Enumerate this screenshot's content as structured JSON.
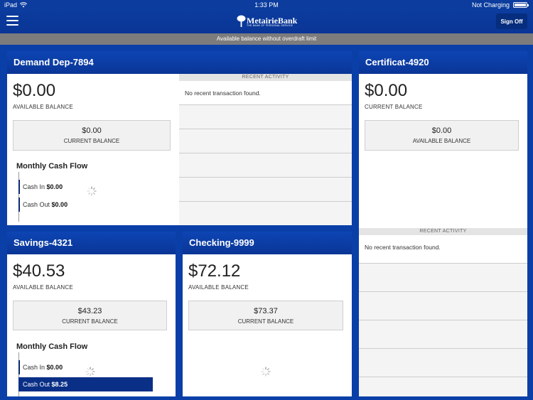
{
  "status_bar": {
    "device": "iPad",
    "time": "1:33 PM",
    "charging": "Not Charging"
  },
  "header": {
    "logo_name": "MetairieBank",
    "logo_tagline": "THE BANK OF PERSONAL SERVICE",
    "sign_off_label": "Sign Off"
  },
  "notice": "Available balance without overdraft limit",
  "accounts": {
    "demand": {
      "title": "Demand Dep-7894",
      "balance": "$0.00",
      "balance_label": "AVAILABLE BALANCE",
      "sub_value": "$0.00",
      "sub_label": "CURRENT BALANCE",
      "cash_flow_title": "Monthly Cash Flow",
      "cash_in_label": "Cash In",
      "cash_in_value": "$0.00",
      "cash_out_label": "Cash Out",
      "cash_out_value": "$0.00",
      "activity_header": "RECENT ACTIVITY",
      "activity_empty": "No recent transaction found."
    },
    "certificate": {
      "title": "Certificat-4920",
      "balance": "$0.00",
      "balance_label": "CURRENT BALANCE",
      "sub_value": "$0.00",
      "sub_label": "AVAILABLE BALANCE",
      "activity_header": "RECENT ACTIVITY",
      "activity_empty": "No recent transaction found."
    },
    "savings": {
      "title": "Savings-4321",
      "balance": "$40.53",
      "balance_label": "AVAILABLE BALANCE",
      "sub_value": "$43.23",
      "sub_label": "CURRENT BALANCE",
      "cash_flow_title": "Monthly Cash Flow",
      "cash_in_label": "Cash In",
      "cash_in_value": "$0.00",
      "cash_out_label": "Cash Out",
      "cash_out_value": "$8.25"
    },
    "checking": {
      "title": "Checking-9999",
      "balance": "$72.12",
      "balance_label": "AVAILABLE BALANCE",
      "sub_value": "$73.37",
      "sub_label": "CURRENT BALANCE"
    }
  },
  "icons": {
    "menu": "hamburger-menu-icon",
    "wifi": "wifi-icon",
    "battery": "battery-icon",
    "loading": "loading-spinner-icon",
    "logo": "tree-logo-icon"
  },
  "colors": {
    "brand_blue": "#0a3fa8",
    "header_blue": "#0b3c9e",
    "cash_out_highlight": "#0a2f86",
    "notice_gray": "#7c7c7c"
  }
}
